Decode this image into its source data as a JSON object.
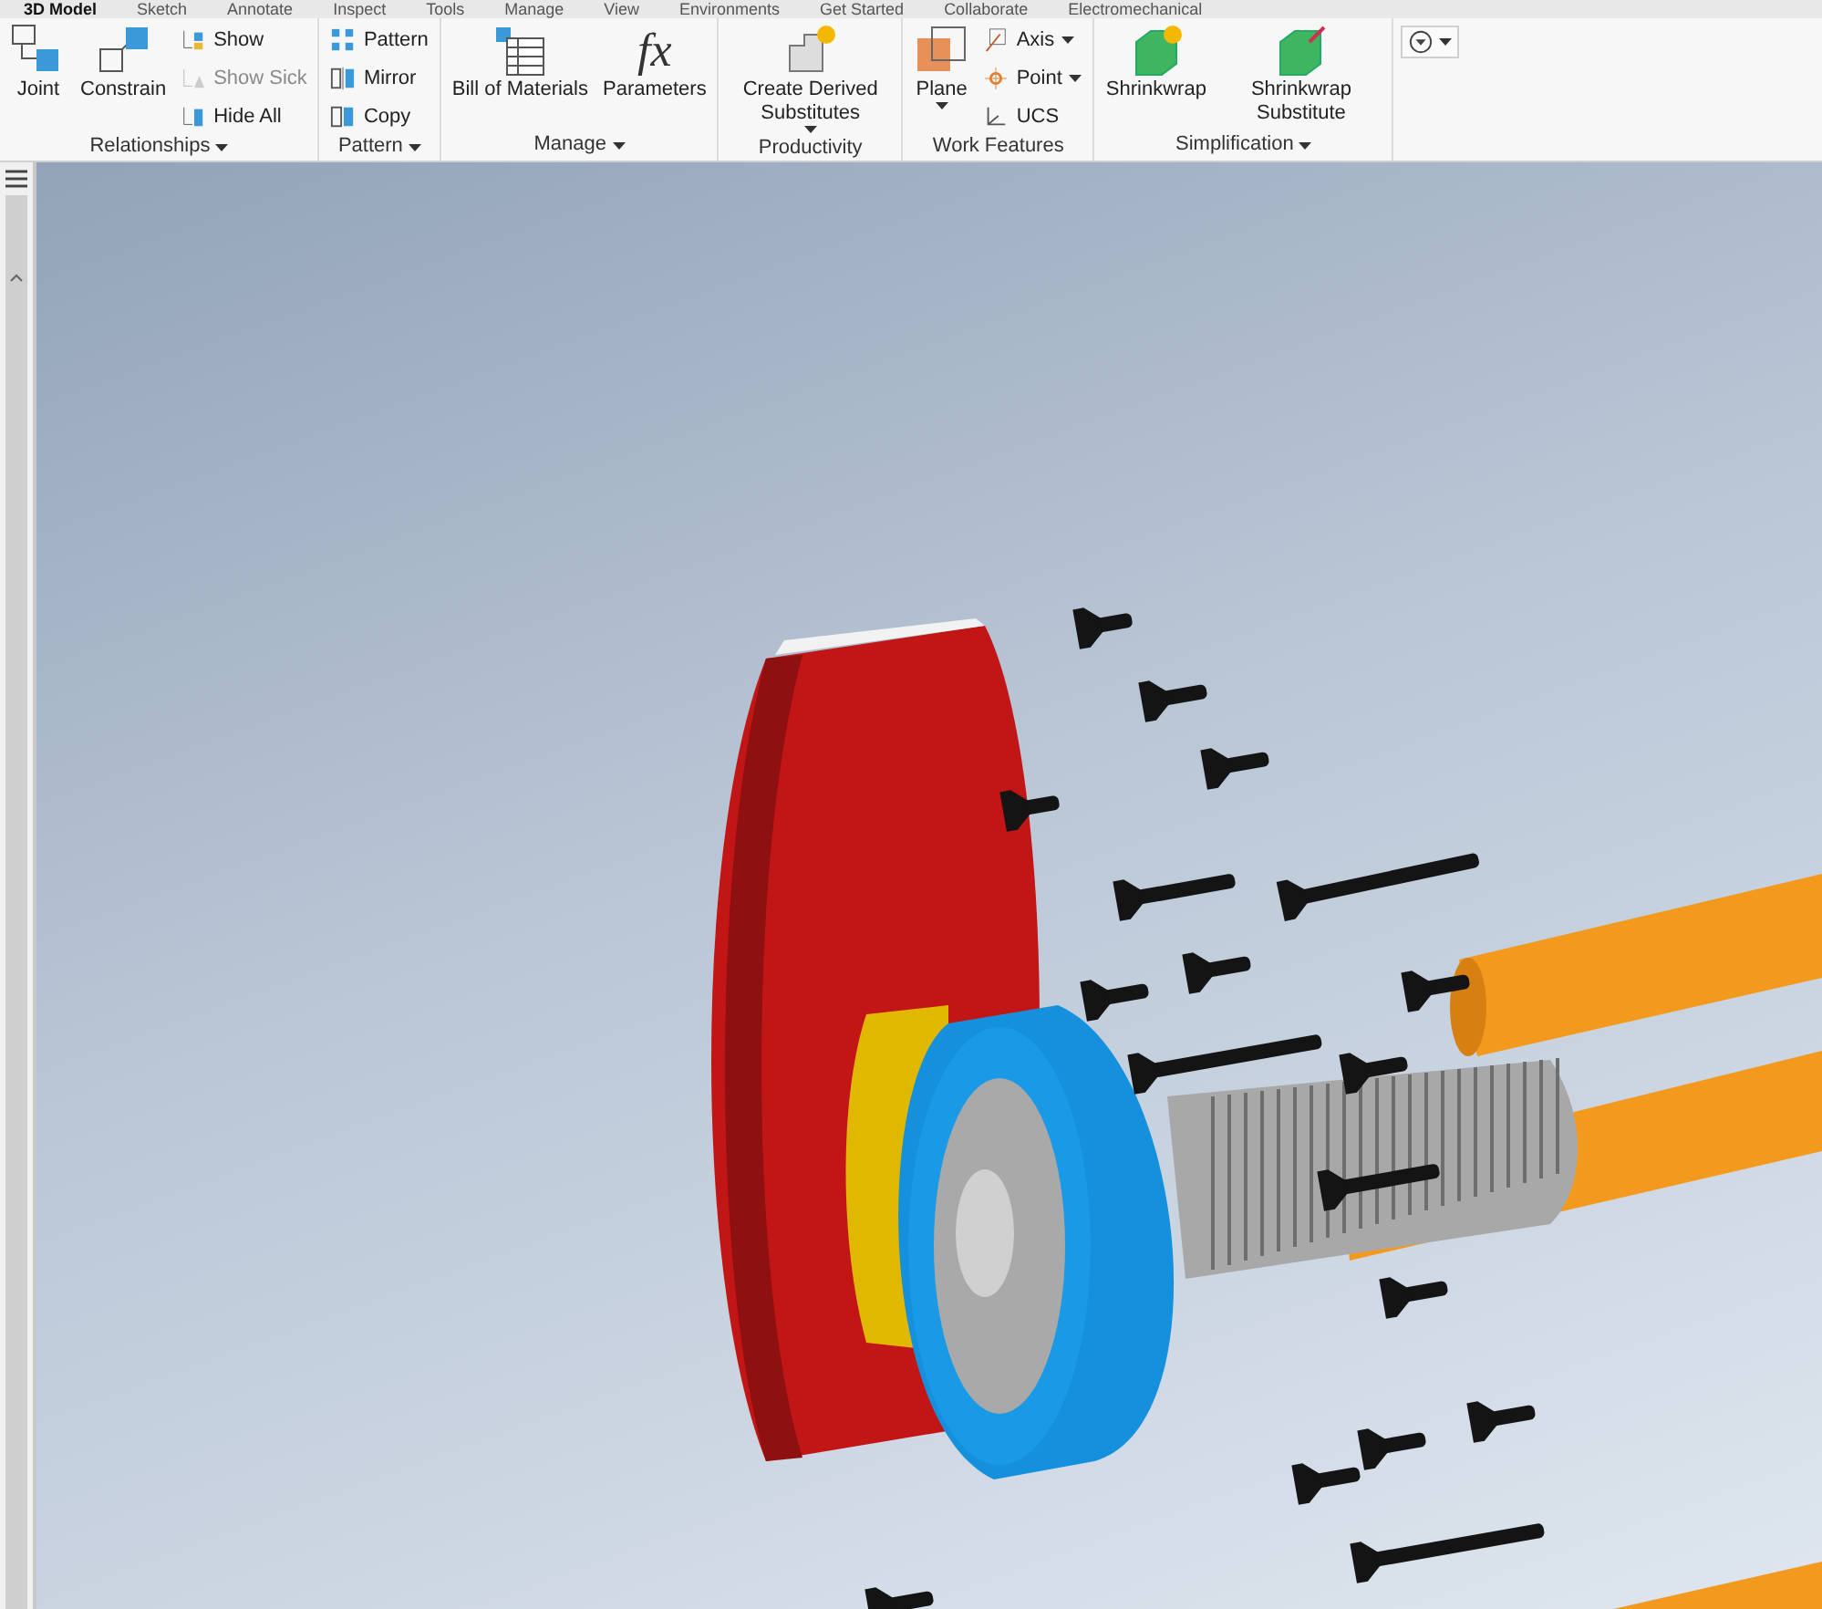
{
  "tabs": [
    {
      "label": "3D Model",
      "selected": true
    },
    {
      "label": "Sketch",
      "selected": false
    },
    {
      "label": "Annotate",
      "selected": false
    },
    {
      "label": "Inspect",
      "selected": false
    },
    {
      "label": "Tools",
      "selected": false
    },
    {
      "label": "Manage",
      "selected": false
    },
    {
      "label": "View",
      "selected": false
    },
    {
      "label": "Environments",
      "selected": false
    },
    {
      "label": "Get Started",
      "selected": false
    },
    {
      "label": "Collaborate",
      "selected": false
    },
    {
      "label": "Electromechanical",
      "selected": false
    }
  ],
  "ribbon_groups": [
    {
      "label": "Relationships",
      "menu": true,
      "tools": [
        {
          "kind": "large",
          "label": "Joint",
          "disabled": false,
          "dropdown": false
        },
        {
          "kind": "large",
          "label": "Constrain",
          "disabled": false,
          "dropdown": false
        },
        {
          "kind": "small",
          "label": "Show",
          "disabled": false,
          "dropdown": false
        },
        {
          "kind": "small",
          "label": "Show Sick",
          "disabled": true,
          "dropdown": false
        },
        {
          "kind": "small",
          "label": "Hide All",
          "disabled": false,
          "dropdown": false
        }
      ]
    },
    {
      "label": "Pattern",
      "menu": true,
      "tools": [
        {
          "kind": "small",
          "label": "Pattern",
          "disabled": false,
          "dropdown": false
        },
        {
          "kind": "small",
          "label": "Mirror",
          "disabled": false,
          "dropdown": false
        },
        {
          "kind": "small",
          "label": "Copy",
          "disabled": false,
          "dropdown": false
        }
      ]
    },
    {
      "label": "Manage",
      "menu": true,
      "tools": [
        {
          "kind": "large",
          "label": "Bill of Materials",
          "disabled": false,
          "dropdown": false
        },
        {
          "kind": "large",
          "label": "Parameters",
          "icon_text": "fx",
          "disabled": false,
          "dropdown": false
        }
      ]
    },
    {
      "label": "Productivity",
      "menu": false,
      "tools": [
        {
          "kind": "large",
          "label": "Create Derived Substitutes",
          "disabled": false,
          "dropdown": true
        }
      ]
    },
    {
      "label": "Work Features",
      "menu": false,
      "tools": [
        {
          "kind": "large",
          "label": "Plane",
          "disabled": false,
          "dropdown": true
        },
        {
          "kind": "small",
          "label": "Axis",
          "disabled": false,
          "dropdown": true
        },
        {
          "kind": "small",
          "label": "Point",
          "disabled": false,
          "dropdown": true
        },
        {
          "kind": "small",
          "label": "UCS",
          "disabled": false,
          "dropdown": false
        }
      ]
    },
    {
      "label": "Simplification",
      "menu": true,
      "tools": [
        {
          "kind": "large",
          "label": "Shrinkwrap",
          "disabled": false,
          "dropdown": false
        },
        {
          "kind": "large",
          "label": "Shrinkwrap Substitute",
          "disabled": false,
          "dropdown": false
        }
      ]
    },
    {
      "tools": [
        {
          "kind": "iconmenu",
          "dropdown": true
        }
      ]
    }
  ]
}
